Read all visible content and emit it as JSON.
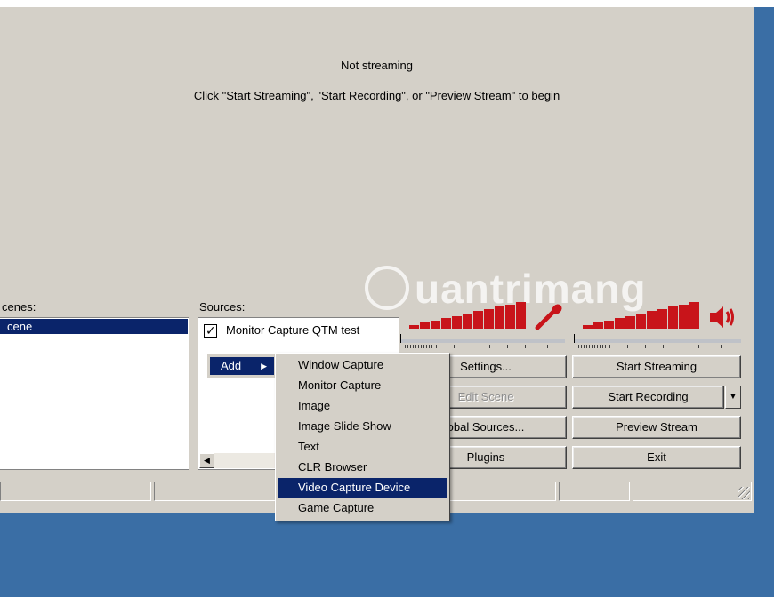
{
  "preview": {
    "status": "Not streaming",
    "hint": "Click \"Start Streaming\", \"Start Recording\", or \"Preview Stream\" to begin"
  },
  "scenes": {
    "label": "cenes:",
    "selected": "cene"
  },
  "sources": {
    "label": "Sources:",
    "items": [
      {
        "name": "Monitor Capture QTM test",
        "checked": true
      }
    ]
  },
  "buttons": {
    "settings": "Settings...",
    "edit_scene": "Edit Scene",
    "global_sources": "obal Sources...",
    "plugins": "Plugins",
    "start_streaming": "Start Streaming",
    "start_recording": "Start Recording",
    "preview_stream": "Preview Stream",
    "exit": "Exit"
  },
  "add_menu": {
    "label": "Add",
    "items": [
      "Window Capture",
      "Monitor Capture",
      "Image",
      "Image Slide Show",
      "Text",
      "CLR Browser",
      "Video Capture Device",
      "Game Capture"
    ],
    "selected": "Video Capture Device"
  },
  "watermark": {
    "text": "uantrimang"
  },
  "meters": {
    "mic_level": 1.0,
    "desktop_level": 1.0,
    "color": "#c8141a"
  },
  "icons": {
    "mic": "microphone-icon",
    "speaker": "speaker-icon",
    "check": "check-icon",
    "submenu": "submenu-arrow-icon"
  }
}
